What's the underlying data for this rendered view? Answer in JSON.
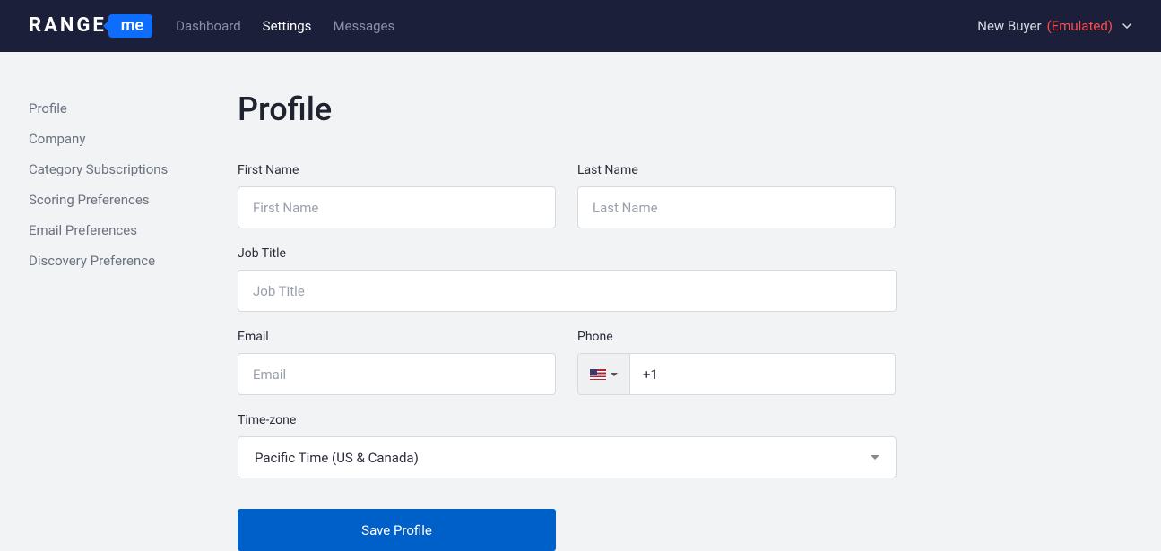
{
  "logo": {
    "text1": "RANGE",
    "text2": "me"
  },
  "nav": {
    "items": [
      {
        "label": "Dashboard",
        "active": false
      },
      {
        "label": "Settings",
        "active": true
      },
      {
        "label": "Messages",
        "active": false
      }
    ]
  },
  "user": {
    "name": "New Buyer",
    "status": "(Emulated)"
  },
  "sidebar": {
    "items": [
      {
        "label": "Profile"
      },
      {
        "label": "Company"
      },
      {
        "label": "Category Subscriptions"
      },
      {
        "label": "Scoring Preferences"
      },
      {
        "label": "Email Preferences"
      },
      {
        "label": "Discovery Preference"
      }
    ]
  },
  "main": {
    "title": "Profile",
    "form": {
      "first_name": {
        "label": "First Name",
        "placeholder": "First Name",
        "value": ""
      },
      "last_name": {
        "label": "Last Name",
        "placeholder": "Last Name",
        "value": ""
      },
      "job_title": {
        "label": "Job Title",
        "placeholder": "Job Title",
        "value": ""
      },
      "email": {
        "label": "Email",
        "placeholder": "Email",
        "value": ""
      },
      "phone": {
        "label": "Phone",
        "value": "+1",
        "country": "us"
      },
      "timezone": {
        "label": "Time-zone",
        "value": "Pacific Time (US & Canada)"
      },
      "save_label": "Save Profile"
    }
  }
}
